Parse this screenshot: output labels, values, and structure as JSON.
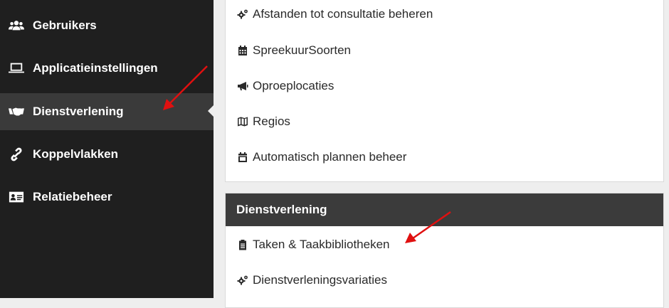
{
  "sidebar": {
    "items": [
      {
        "label": "Gebruikers",
        "icon": "users-icon"
      },
      {
        "label": "Applicatieinstellingen",
        "icon": "laptop-icon"
      },
      {
        "label": "Dienstverlening",
        "icon": "handshake-icon",
        "active": true
      },
      {
        "label": "Koppelvlakken",
        "icon": "link-icon"
      },
      {
        "label": "Relatiebeheer",
        "icon": "id-card-icon"
      }
    ]
  },
  "panel1": {
    "items": [
      {
        "label": "Afstanden tot consultatie beheren",
        "icon": "cogs-icon"
      },
      {
        "label": "SpreekuurSoorten",
        "icon": "calendar-icon"
      },
      {
        "label": "Oproeplocaties",
        "icon": "bullhorn-icon"
      },
      {
        "label": "Regios",
        "icon": "map-icon"
      },
      {
        "label": "Automatisch plannen beheer",
        "icon": "calendar-minus-icon"
      }
    ]
  },
  "panel2": {
    "header": "Dienstverlening",
    "items": [
      {
        "label": "Taken & Taakbibliotheken",
        "icon": "clipboard-icon"
      },
      {
        "label": "Dienstverleningsvariaties",
        "icon": "cogs-icon"
      }
    ]
  },
  "colors": {
    "sidebar_bg": "#1f1f1f",
    "sidebar_active": "#3a3a3a",
    "panel_header": "#3b3b3b",
    "annotation_arrow": "#e01010"
  }
}
